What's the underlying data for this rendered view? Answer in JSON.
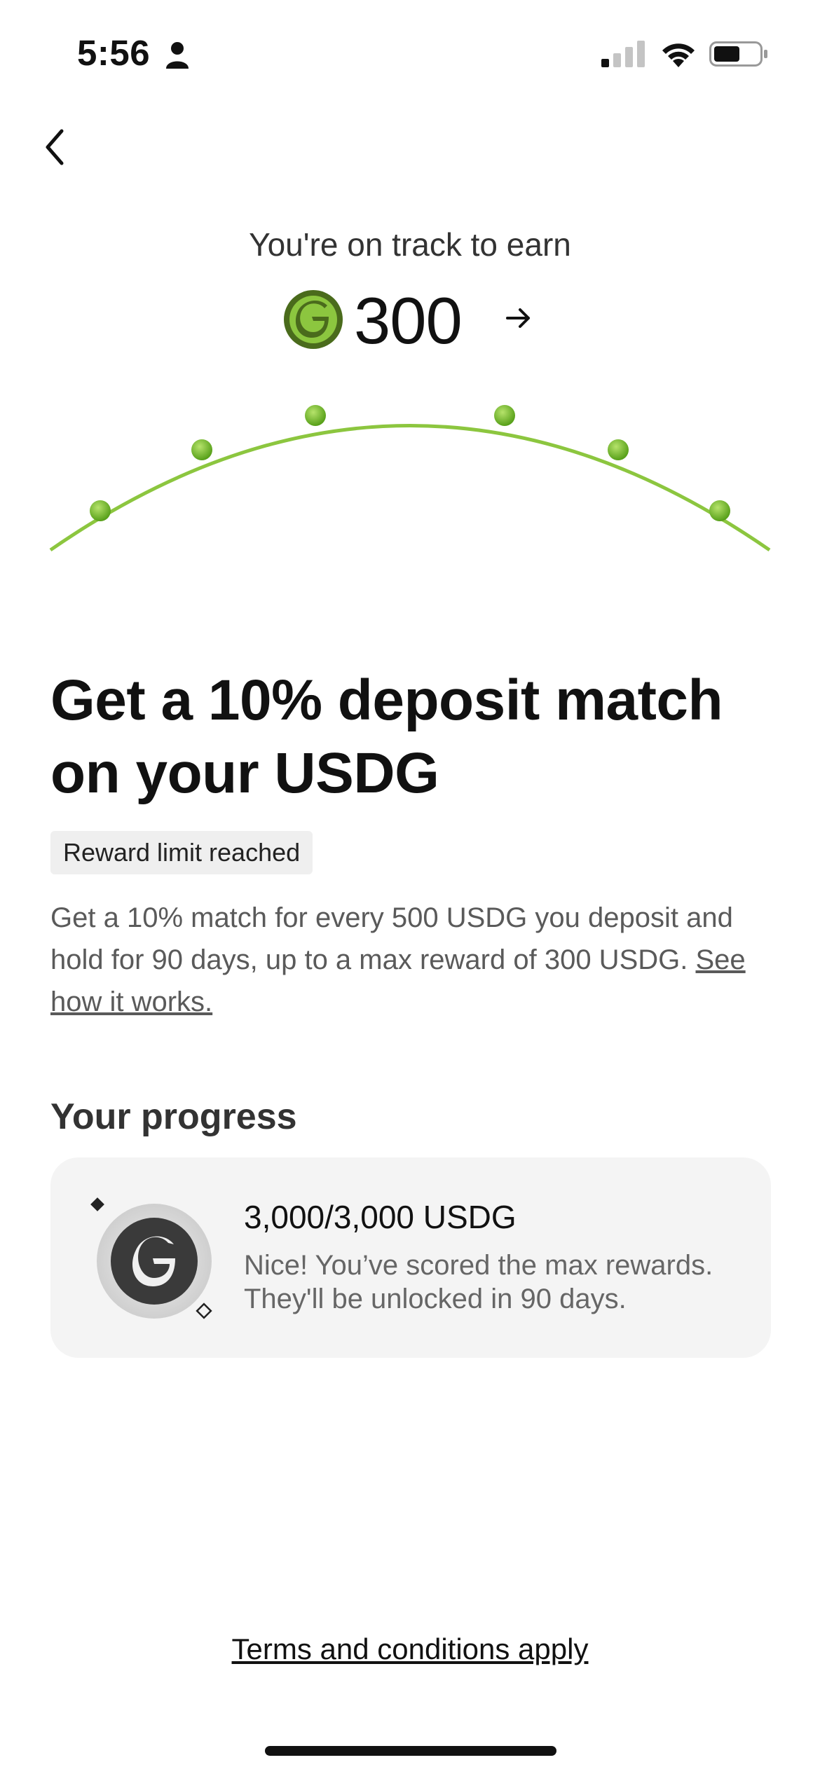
{
  "status_bar": {
    "time": "5:56"
  },
  "header": {
    "earn_caption": "You're on track to earn",
    "earn_amount": "300"
  },
  "offer": {
    "headline": "Get a 10% deposit match on your USDG",
    "badge": "Reward limit reached",
    "description": "Get a 10% match for every 500 USDG you deposit and hold for 90 days, up to a max reward of 300 USDG.",
    "how_it_works_link": "See how it works."
  },
  "progress": {
    "title": "Your progress",
    "amount": "3,000/3,000 USDG",
    "message": "Nice! You’ve scored the max rewards. They'll be unlocked in 90 days.",
    "fraction_complete": 1.0
  },
  "footer": {
    "terms_link": "Terms and conditions apply"
  },
  "colors": {
    "accent_green": "#8cc63f",
    "coin_dark": "#4a6b1c",
    "card_background": "#f4f4f4"
  },
  "icons": {
    "back": "chevron-left-icon",
    "coin": "usdg-coin-icon",
    "arrow": "arrow-right-icon"
  }
}
